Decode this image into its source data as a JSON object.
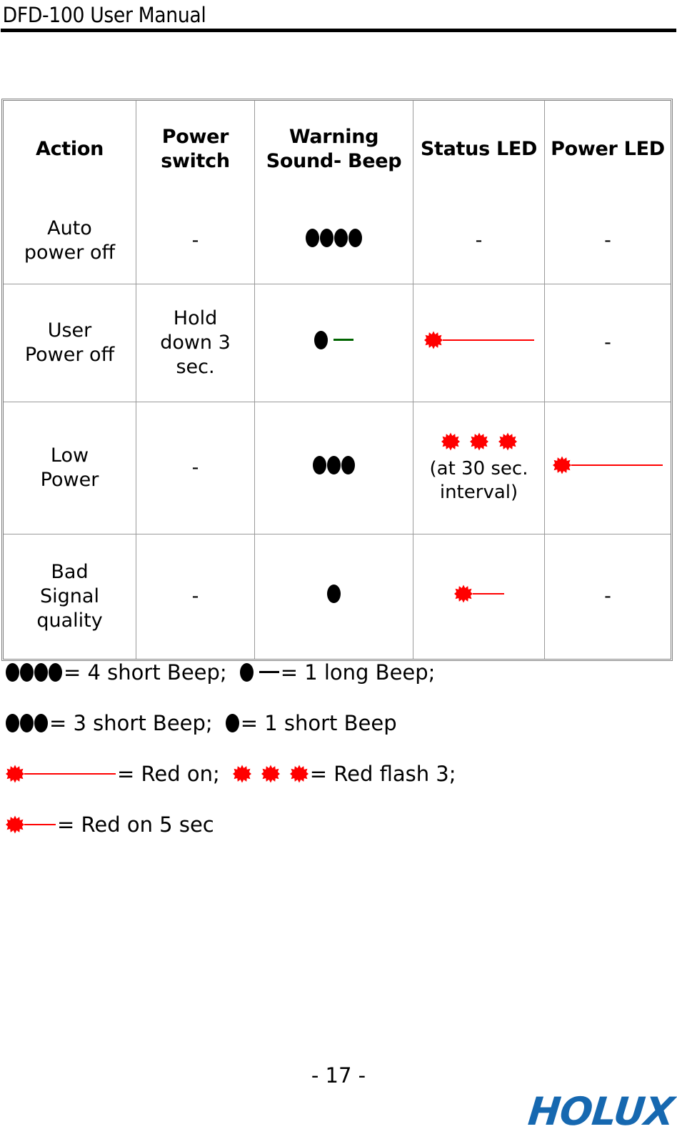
{
  "header": {
    "title": "DFD-100 User Manual"
  },
  "table": {
    "columns": [
      "Action",
      "Power switch",
      "Warning Sound- Beep",
      "Status LED",
      "Power LED"
    ],
    "column_lines": [
      [
        "Action"
      ],
      [
        "Power",
        "switch"
      ],
      [
        "Warning",
        "Sound- Beep"
      ],
      [
        "Status LED"
      ],
      [
        "Power LED"
      ]
    ],
    "rows": [
      {
        "action": [
          "Auto",
          "power off"
        ],
        "power_switch": "-",
        "warning_beep_symbol": "4-short-beep",
        "warning_beep_count": 4,
        "status_led_symbol": "none",
        "status_led_text": "-",
        "power_led_symbol": "none",
        "power_led_text": "-"
      },
      {
        "action": [
          "User",
          "Power off"
        ],
        "power_switch": "Hold down 3 sec.",
        "power_switch_lines": [
          "Hold",
          "down 3",
          "sec."
        ],
        "warning_beep_symbol": "1-long-beep",
        "warning_beep_count": 1,
        "status_led_symbol": "red-on",
        "status_led_text": "",
        "power_led_symbol": "none",
        "power_led_text": "-"
      },
      {
        "action": [
          "Low",
          "Power"
        ],
        "power_switch": "-",
        "warning_beep_symbol": "3-short-beep",
        "warning_beep_count": 3,
        "status_led_symbol": "red-flash-3",
        "status_led_text": "(at 30 sec. interval)",
        "status_led_text_lines": [
          "(at 30 sec.",
          "interval)"
        ],
        "power_led_symbol": "red-on",
        "power_led_text": ""
      },
      {
        "action": [
          "Bad",
          "Signal",
          "quality"
        ],
        "power_switch": "-",
        "warning_beep_symbol": "1-short-beep",
        "warning_beep_count": 1,
        "status_led_symbol": "red-on-5-sec",
        "status_led_text": "",
        "power_led_symbol": "none",
        "power_led_text": "-"
      }
    ]
  },
  "legend": {
    "lines": [
      {
        "left_symbol": "4-short-beep",
        "left_text": "= 4 short Beep;",
        "right_symbol": "1-long-beep",
        "right_text": "= 1 long Beep;"
      },
      {
        "left_symbol": "3-short-beep",
        "left_text": "= 3 short Beep;",
        "right_symbol": "1-short-beep",
        "right_text": "= 1 short Beep"
      },
      {
        "left_symbol": "red-on",
        "left_text": "=  Red on;",
        "right_symbol": "red-flash-3",
        "right_text": "= Red flash 3;"
      },
      {
        "left_symbol": "red-on-5-sec",
        "left_text": "=  Red on 5 sec",
        "right_symbol": "",
        "right_text": ""
      }
    ]
  },
  "footer": {
    "page_number": "- 17 -",
    "logo_text": "HOLUX"
  },
  "colors": {
    "led_red": "#ff0000",
    "beep_black": "#000000",
    "long_beep_tail_green": "#006400",
    "logo_blue": "#1668b0",
    "table_border": "#808080",
    "table_grid": "#9a9a9a"
  }
}
